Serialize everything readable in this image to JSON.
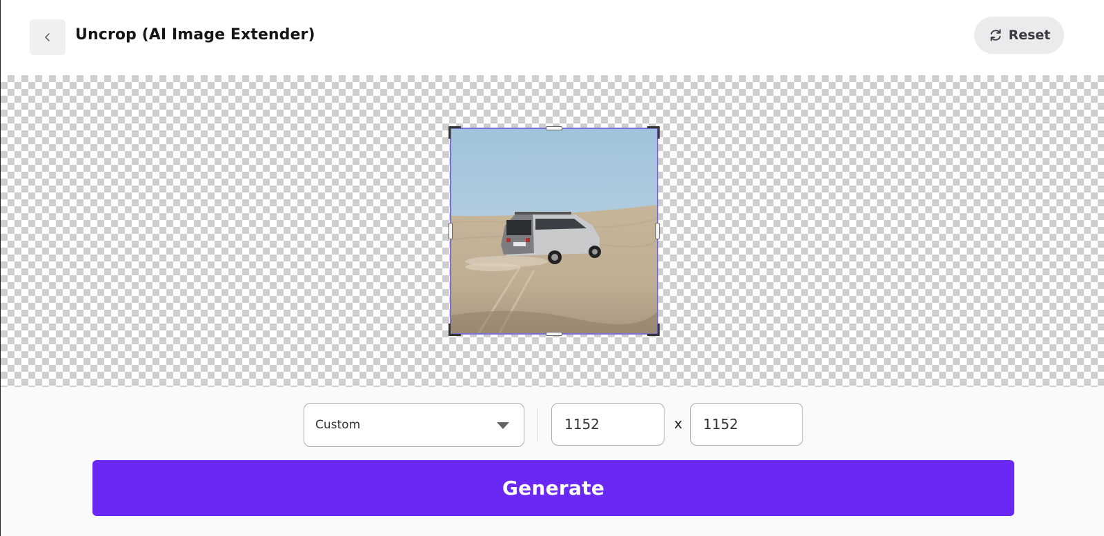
{
  "header": {
    "title": "Uncrop (AI Image Extender)",
    "back_icon": "chevron-left-icon",
    "reset_label": "Reset",
    "reset_icon": "refresh-icon"
  },
  "canvas": {
    "image_subject": "silver SUV driving on desert sand dune",
    "handle_color": "#7b6fd6"
  },
  "controls": {
    "aspect_select": {
      "value": "Custom"
    },
    "width_value": "1152",
    "times_label": "x",
    "height_value": "1152",
    "generate_label": "Generate"
  },
  "colors": {
    "accent": "#6928f3",
    "reset_bg": "#ebebed"
  }
}
